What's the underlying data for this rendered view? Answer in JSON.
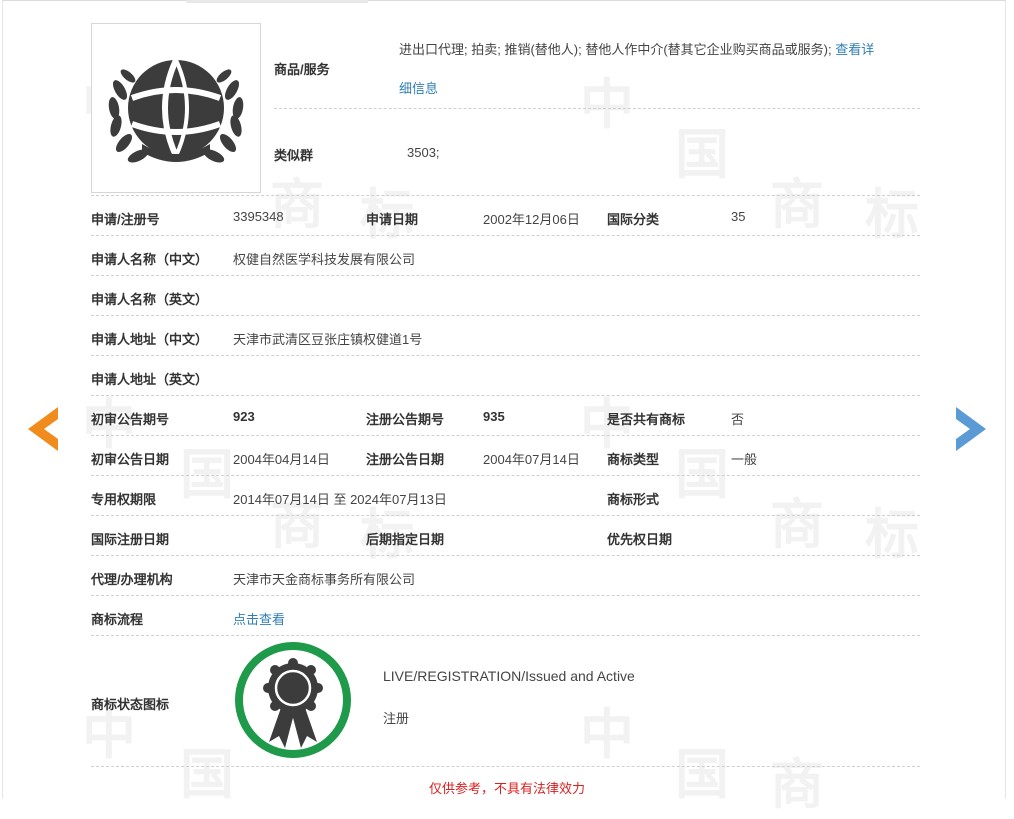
{
  "header": {
    "goods_label": "商品/服务",
    "goods_text": "进出口代理; 拍卖; 推销(替他人); 替他人作中介(替其它企业购买商品或服务);",
    "goods_link_1": "查看详",
    "goods_link_2": "细信息",
    "similar_group_label": "类似群",
    "similar_group_value": "3503;"
  },
  "rows": {
    "app_no_label": "申请/注册号",
    "app_no_value": "3395348",
    "app_date_label": "申请日期",
    "app_date_value": "2002年12月06日",
    "intl_class_label": "国际分类",
    "intl_class_value": "35",
    "applicant_cn_label": "申请人名称（中文）",
    "applicant_cn_value": "权健自然医学科技发展有限公司",
    "applicant_en_label": "申请人名称（英文）",
    "address_cn_label": "申请人地址（中文）",
    "address_cn_value": "天津市武清区豆张庄镇权健道1号",
    "address_en_label": "申请人地址（英文）",
    "prelim_issue_label": "初审公告期号",
    "prelim_issue_value": "923",
    "reg_issue_label": "注册公告期号",
    "reg_issue_value": "935",
    "shared_label": "是否共有商标",
    "shared_value": "否",
    "prelim_date_label": "初审公告日期",
    "prelim_date_value": "2004年04月14日",
    "reg_date_label": "注册公告日期",
    "reg_date_value": "2004年07月14日",
    "tm_type_label": "商标类型",
    "tm_type_value": "一般",
    "exclusive_label": "专用权期限",
    "exclusive_value": "2014年07月14日 至 2024年07月13日",
    "tm_form_label": "商标形式",
    "intl_reg_date_label": "国际注册日期",
    "later_date_label": "后期指定日期",
    "priority_date_label": "优先权日期",
    "agent_label": "代理/办理机构",
    "agent_value": "天津市天金商标事务所有限公司",
    "process_label": "商标流程",
    "process_link": "点击查看",
    "status_icon_label": "商标状态图标",
    "status_en": "LIVE/REGISTRATION/Issued and Active",
    "status_cn": "注册"
  },
  "footer": {
    "disclaimer": "仅供参考，不具有法律效力"
  },
  "colors": {
    "link": "#2f7fb6",
    "prev_arrow": "#f08c1e",
    "next_arrow": "#5b9bd5",
    "status_ring": "#1e9a4a",
    "disclaimer": "#d92020"
  },
  "icons": {
    "trademark_logo": "globe-laurel-logo",
    "prev": "arrow-left-icon",
    "next": "arrow-right-icon",
    "status": "award-ribbon-icon"
  }
}
